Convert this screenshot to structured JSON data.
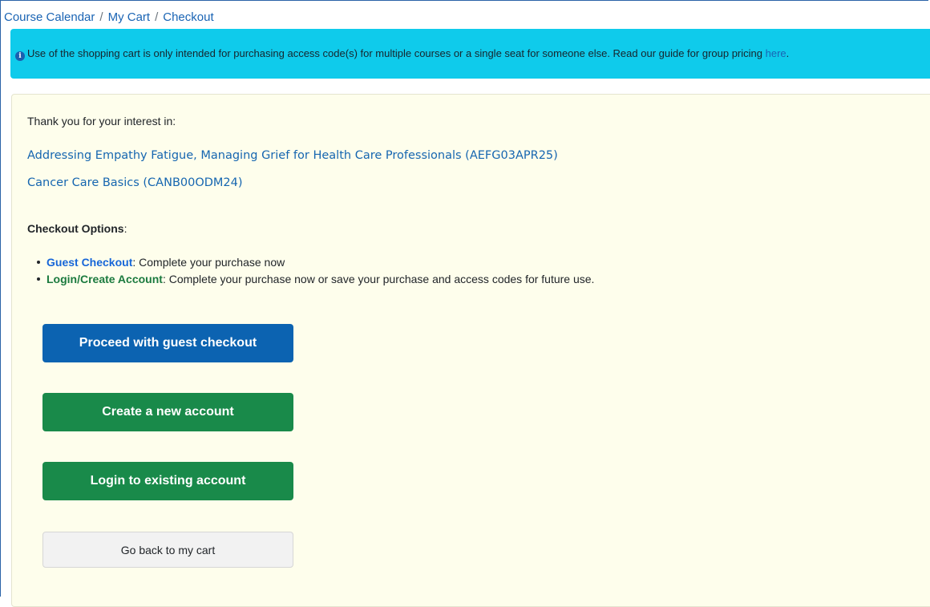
{
  "breadcrumb": {
    "items": [
      "Course Calendar",
      "My Cart",
      "Checkout"
    ],
    "separator": "/"
  },
  "banner": {
    "icon": "info-circle-icon",
    "message": "Use of the shopping cart is only intended for purchasing access code(s) for multiple courses or a single seat for someone else. Read our guide for group pricing ",
    "link_text": "here",
    "trailing": ".",
    "background_color": "#0fcbeb"
  },
  "content": {
    "intro": "Thank you for your interest in:",
    "courses": [
      "Addressing Empathy Fatigue, Managing Grief for Health Care Professionals (AEFG03APR25)",
      "Cancer Care Basics (CANB00ODM24)"
    ],
    "options_heading": "Checkout Options",
    "options_colon": ":",
    "options": [
      {
        "label": "Guest Checkout",
        "desc": ": Complete your purchase now"
      },
      {
        "label": "Login/Create Account",
        "desc": ": Complete your purchase now or save your purchase and access codes for future use."
      }
    ]
  },
  "buttons": {
    "guest": "Proceed with guest checkout",
    "create": "Create a new account",
    "login": "Login to existing account",
    "back": "Go back to my cart"
  },
  "colors": {
    "link": "#1a64b4",
    "panel_background": "#fefeec",
    "primary_button": "#0c63b1",
    "success_button": "#198a4a",
    "secondary_button": "#f2f2f2"
  }
}
